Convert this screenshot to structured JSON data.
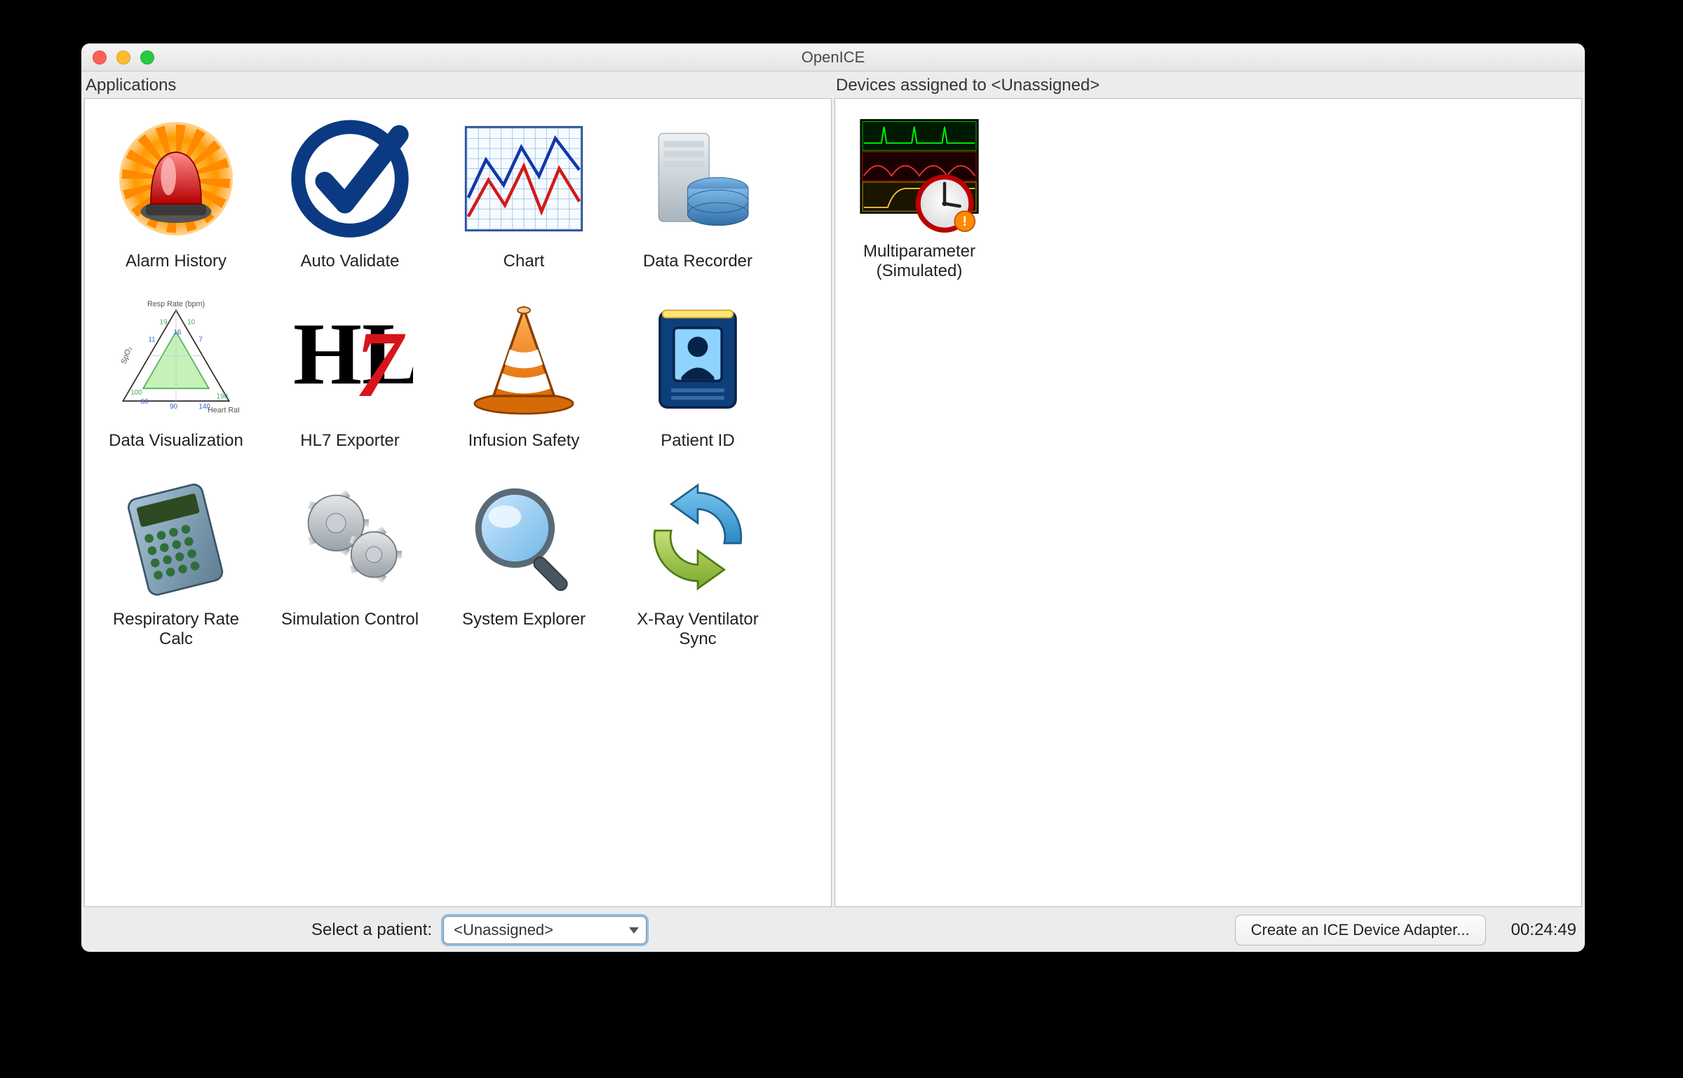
{
  "window": {
    "title": "OpenICE"
  },
  "panels": {
    "apps_heading": "Applications",
    "devices_heading": "Devices assigned to <Unassigned>"
  },
  "apps": [
    {
      "id": "alarm-history",
      "label": "Alarm History",
      "icon": "alarm"
    },
    {
      "id": "auto-validate",
      "label": "Auto Validate",
      "icon": "check"
    },
    {
      "id": "chart",
      "label": "Chart",
      "icon": "chart"
    },
    {
      "id": "data-recorder",
      "label": "Data Recorder",
      "icon": "database"
    },
    {
      "id": "data-viz",
      "label": "Data Visualization",
      "icon": "triangle"
    },
    {
      "id": "hl7-exporter",
      "label": "HL7 Exporter",
      "icon": "hl7"
    },
    {
      "id": "infusion-safety",
      "label": "Infusion Safety",
      "icon": "cone"
    },
    {
      "id": "patient-id",
      "label": "Patient ID",
      "icon": "idcard"
    },
    {
      "id": "resp-rate-calc",
      "label": "Respiratory Rate Calc",
      "icon": "calculator"
    },
    {
      "id": "sim-control",
      "label": "Simulation Control",
      "icon": "gears"
    },
    {
      "id": "system-explorer",
      "label": "System Explorer",
      "icon": "magnifier"
    },
    {
      "id": "xray-vent-sync",
      "label": "X-Ray Ventilator Sync",
      "icon": "sync"
    }
  ],
  "devices": [
    {
      "id": "multiparam-sim",
      "label": "Multiparameter (Simulated)",
      "icon": "monitor-clock"
    }
  ],
  "footer": {
    "select_label": "Select a patient:",
    "select_value": "<Unassigned>",
    "create_adapter_label": "Create an ICE Device Adapter...",
    "clock": "00:24:49"
  }
}
